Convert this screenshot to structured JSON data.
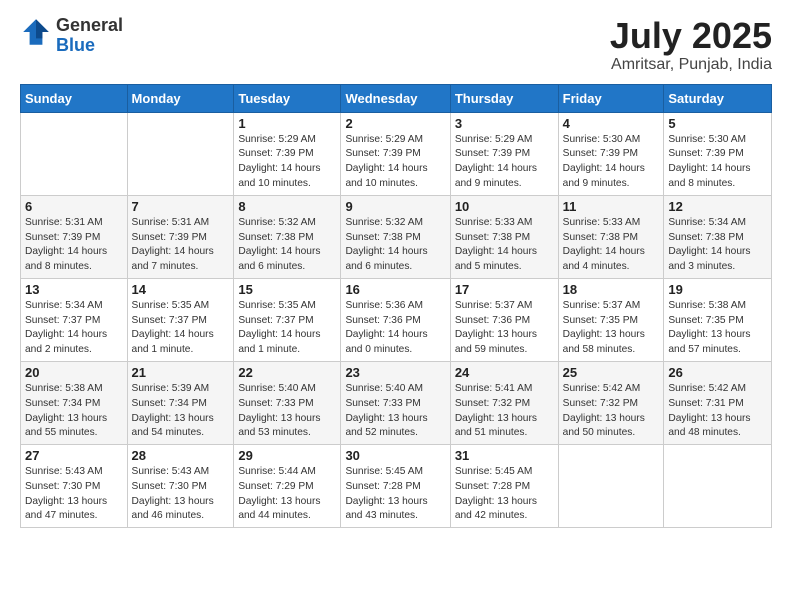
{
  "logo": {
    "general": "General",
    "blue": "Blue"
  },
  "header": {
    "month": "July 2025",
    "location": "Amritsar, Punjab, India"
  },
  "weekdays": [
    "Sunday",
    "Monday",
    "Tuesday",
    "Wednesday",
    "Thursday",
    "Friday",
    "Saturday"
  ],
  "weeks": [
    [
      {
        "day": "",
        "info": ""
      },
      {
        "day": "",
        "info": ""
      },
      {
        "day": "1",
        "info": "Sunrise: 5:29 AM\nSunset: 7:39 PM\nDaylight: 14 hours and 10 minutes."
      },
      {
        "day": "2",
        "info": "Sunrise: 5:29 AM\nSunset: 7:39 PM\nDaylight: 14 hours and 10 minutes."
      },
      {
        "day": "3",
        "info": "Sunrise: 5:29 AM\nSunset: 7:39 PM\nDaylight: 14 hours and 9 minutes."
      },
      {
        "day": "4",
        "info": "Sunrise: 5:30 AM\nSunset: 7:39 PM\nDaylight: 14 hours and 9 minutes."
      },
      {
        "day": "5",
        "info": "Sunrise: 5:30 AM\nSunset: 7:39 PM\nDaylight: 14 hours and 8 minutes."
      }
    ],
    [
      {
        "day": "6",
        "info": "Sunrise: 5:31 AM\nSunset: 7:39 PM\nDaylight: 14 hours and 8 minutes."
      },
      {
        "day": "7",
        "info": "Sunrise: 5:31 AM\nSunset: 7:39 PM\nDaylight: 14 hours and 7 minutes."
      },
      {
        "day": "8",
        "info": "Sunrise: 5:32 AM\nSunset: 7:38 PM\nDaylight: 14 hours and 6 minutes."
      },
      {
        "day": "9",
        "info": "Sunrise: 5:32 AM\nSunset: 7:38 PM\nDaylight: 14 hours and 6 minutes."
      },
      {
        "day": "10",
        "info": "Sunrise: 5:33 AM\nSunset: 7:38 PM\nDaylight: 14 hours and 5 minutes."
      },
      {
        "day": "11",
        "info": "Sunrise: 5:33 AM\nSunset: 7:38 PM\nDaylight: 14 hours and 4 minutes."
      },
      {
        "day": "12",
        "info": "Sunrise: 5:34 AM\nSunset: 7:38 PM\nDaylight: 14 hours and 3 minutes."
      }
    ],
    [
      {
        "day": "13",
        "info": "Sunrise: 5:34 AM\nSunset: 7:37 PM\nDaylight: 14 hours and 2 minutes."
      },
      {
        "day": "14",
        "info": "Sunrise: 5:35 AM\nSunset: 7:37 PM\nDaylight: 14 hours and 1 minute."
      },
      {
        "day": "15",
        "info": "Sunrise: 5:35 AM\nSunset: 7:37 PM\nDaylight: 14 hours and 1 minute."
      },
      {
        "day": "16",
        "info": "Sunrise: 5:36 AM\nSunset: 7:36 PM\nDaylight: 14 hours and 0 minutes."
      },
      {
        "day": "17",
        "info": "Sunrise: 5:37 AM\nSunset: 7:36 PM\nDaylight: 13 hours and 59 minutes."
      },
      {
        "day": "18",
        "info": "Sunrise: 5:37 AM\nSunset: 7:35 PM\nDaylight: 13 hours and 58 minutes."
      },
      {
        "day": "19",
        "info": "Sunrise: 5:38 AM\nSunset: 7:35 PM\nDaylight: 13 hours and 57 minutes."
      }
    ],
    [
      {
        "day": "20",
        "info": "Sunrise: 5:38 AM\nSunset: 7:34 PM\nDaylight: 13 hours and 55 minutes."
      },
      {
        "day": "21",
        "info": "Sunrise: 5:39 AM\nSunset: 7:34 PM\nDaylight: 13 hours and 54 minutes."
      },
      {
        "day": "22",
        "info": "Sunrise: 5:40 AM\nSunset: 7:33 PM\nDaylight: 13 hours and 53 minutes."
      },
      {
        "day": "23",
        "info": "Sunrise: 5:40 AM\nSunset: 7:33 PM\nDaylight: 13 hours and 52 minutes."
      },
      {
        "day": "24",
        "info": "Sunrise: 5:41 AM\nSunset: 7:32 PM\nDaylight: 13 hours and 51 minutes."
      },
      {
        "day": "25",
        "info": "Sunrise: 5:42 AM\nSunset: 7:32 PM\nDaylight: 13 hours and 50 minutes."
      },
      {
        "day": "26",
        "info": "Sunrise: 5:42 AM\nSunset: 7:31 PM\nDaylight: 13 hours and 48 minutes."
      }
    ],
    [
      {
        "day": "27",
        "info": "Sunrise: 5:43 AM\nSunset: 7:30 PM\nDaylight: 13 hours and 47 minutes."
      },
      {
        "day": "28",
        "info": "Sunrise: 5:43 AM\nSunset: 7:30 PM\nDaylight: 13 hours and 46 minutes."
      },
      {
        "day": "29",
        "info": "Sunrise: 5:44 AM\nSunset: 7:29 PM\nDaylight: 13 hours and 44 minutes."
      },
      {
        "day": "30",
        "info": "Sunrise: 5:45 AM\nSunset: 7:28 PM\nDaylight: 13 hours and 43 minutes."
      },
      {
        "day": "31",
        "info": "Sunrise: 5:45 AM\nSunset: 7:28 PM\nDaylight: 13 hours and 42 minutes."
      },
      {
        "day": "",
        "info": ""
      },
      {
        "day": "",
        "info": ""
      }
    ]
  ]
}
